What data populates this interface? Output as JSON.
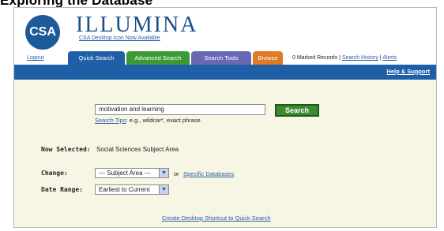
{
  "page_heading": "Exploring the Database",
  "header": {
    "logo_text": "CSA",
    "brand": "ILLUMINA",
    "promo_link": "CSA Desktop Icon Now Available"
  },
  "nav": {
    "logout": "Logout",
    "tabs": [
      {
        "label": "Quick Search",
        "color": "#1e5fa8"
      },
      {
        "label": "Advanced Search",
        "color": "#3c9a35"
      },
      {
        "label": "Search Tools",
        "color": "#6a68b4"
      },
      {
        "label": "Browse",
        "color": "#e07a24"
      }
    ],
    "marked_records": "0 Marked Records",
    "separator": "|",
    "search_history": "Search History",
    "alerts": "Alerts"
  },
  "bar": {
    "help_support": "Help & Support"
  },
  "search": {
    "query_value": "motivation and learning",
    "button_label": "Search",
    "tips_link": "Search Tips",
    "tips_text": ": e.g., wildcar*, exact phrase"
  },
  "selection": {
    "now_selected_label": "Now Selected:",
    "now_selected_value": "Social Sciences Subject Area",
    "change_label": "Change:",
    "subject_area_select": "--- Subject Area ---",
    "or_text": "or",
    "specific_databases": "Specific Databases",
    "date_range_label": "Date Range:",
    "date_range_select": "Earliest to Current"
  },
  "footer": {
    "shortcut_link": "Create Desktop Shortcut to Quick Search"
  }
}
